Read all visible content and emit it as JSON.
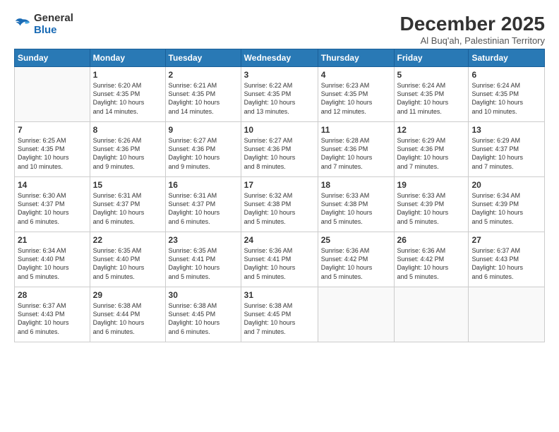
{
  "logo": {
    "line1": "General",
    "line2": "Blue"
  },
  "title": "December 2025",
  "subtitle": "Al Buq'ah, Palestinian Territory",
  "days_header": [
    "Sunday",
    "Monday",
    "Tuesday",
    "Wednesday",
    "Thursday",
    "Friday",
    "Saturday"
  ],
  "weeks": [
    [
      {
        "day": "",
        "info": ""
      },
      {
        "day": "1",
        "info": "Sunrise: 6:20 AM\nSunset: 4:35 PM\nDaylight: 10 hours\nand 14 minutes."
      },
      {
        "day": "2",
        "info": "Sunrise: 6:21 AM\nSunset: 4:35 PM\nDaylight: 10 hours\nand 14 minutes."
      },
      {
        "day": "3",
        "info": "Sunrise: 6:22 AM\nSunset: 4:35 PM\nDaylight: 10 hours\nand 13 minutes."
      },
      {
        "day": "4",
        "info": "Sunrise: 6:23 AM\nSunset: 4:35 PM\nDaylight: 10 hours\nand 12 minutes."
      },
      {
        "day": "5",
        "info": "Sunrise: 6:24 AM\nSunset: 4:35 PM\nDaylight: 10 hours\nand 11 minutes."
      },
      {
        "day": "6",
        "info": "Sunrise: 6:24 AM\nSunset: 4:35 PM\nDaylight: 10 hours\nand 10 minutes."
      }
    ],
    [
      {
        "day": "7",
        "info": "Sunrise: 6:25 AM\nSunset: 4:35 PM\nDaylight: 10 hours\nand 10 minutes."
      },
      {
        "day": "8",
        "info": "Sunrise: 6:26 AM\nSunset: 4:36 PM\nDaylight: 10 hours\nand 9 minutes."
      },
      {
        "day": "9",
        "info": "Sunrise: 6:27 AM\nSunset: 4:36 PM\nDaylight: 10 hours\nand 9 minutes."
      },
      {
        "day": "10",
        "info": "Sunrise: 6:27 AM\nSunset: 4:36 PM\nDaylight: 10 hours\nand 8 minutes."
      },
      {
        "day": "11",
        "info": "Sunrise: 6:28 AM\nSunset: 4:36 PM\nDaylight: 10 hours\nand 7 minutes."
      },
      {
        "day": "12",
        "info": "Sunrise: 6:29 AM\nSunset: 4:36 PM\nDaylight: 10 hours\nand 7 minutes."
      },
      {
        "day": "13",
        "info": "Sunrise: 6:29 AM\nSunset: 4:37 PM\nDaylight: 10 hours\nand 7 minutes."
      }
    ],
    [
      {
        "day": "14",
        "info": "Sunrise: 6:30 AM\nSunset: 4:37 PM\nDaylight: 10 hours\nand 6 minutes."
      },
      {
        "day": "15",
        "info": "Sunrise: 6:31 AM\nSunset: 4:37 PM\nDaylight: 10 hours\nand 6 minutes."
      },
      {
        "day": "16",
        "info": "Sunrise: 6:31 AM\nSunset: 4:37 PM\nDaylight: 10 hours\nand 6 minutes."
      },
      {
        "day": "17",
        "info": "Sunrise: 6:32 AM\nSunset: 4:38 PM\nDaylight: 10 hours\nand 5 minutes."
      },
      {
        "day": "18",
        "info": "Sunrise: 6:33 AM\nSunset: 4:38 PM\nDaylight: 10 hours\nand 5 minutes."
      },
      {
        "day": "19",
        "info": "Sunrise: 6:33 AM\nSunset: 4:39 PM\nDaylight: 10 hours\nand 5 minutes."
      },
      {
        "day": "20",
        "info": "Sunrise: 6:34 AM\nSunset: 4:39 PM\nDaylight: 10 hours\nand 5 minutes."
      }
    ],
    [
      {
        "day": "21",
        "info": "Sunrise: 6:34 AM\nSunset: 4:40 PM\nDaylight: 10 hours\nand 5 minutes."
      },
      {
        "day": "22",
        "info": "Sunrise: 6:35 AM\nSunset: 4:40 PM\nDaylight: 10 hours\nand 5 minutes."
      },
      {
        "day": "23",
        "info": "Sunrise: 6:35 AM\nSunset: 4:41 PM\nDaylight: 10 hours\nand 5 minutes."
      },
      {
        "day": "24",
        "info": "Sunrise: 6:36 AM\nSunset: 4:41 PM\nDaylight: 10 hours\nand 5 minutes."
      },
      {
        "day": "25",
        "info": "Sunrise: 6:36 AM\nSunset: 4:42 PM\nDaylight: 10 hours\nand 5 minutes."
      },
      {
        "day": "26",
        "info": "Sunrise: 6:36 AM\nSunset: 4:42 PM\nDaylight: 10 hours\nand 5 minutes."
      },
      {
        "day": "27",
        "info": "Sunrise: 6:37 AM\nSunset: 4:43 PM\nDaylight: 10 hours\nand 6 minutes."
      }
    ],
    [
      {
        "day": "28",
        "info": "Sunrise: 6:37 AM\nSunset: 4:43 PM\nDaylight: 10 hours\nand 6 minutes."
      },
      {
        "day": "29",
        "info": "Sunrise: 6:38 AM\nSunset: 4:44 PM\nDaylight: 10 hours\nand 6 minutes."
      },
      {
        "day": "30",
        "info": "Sunrise: 6:38 AM\nSunset: 4:45 PM\nDaylight: 10 hours\nand 6 minutes."
      },
      {
        "day": "31",
        "info": "Sunrise: 6:38 AM\nSunset: 4:45 PM\nDaylight: 10 hours\nand 7 minutes."
      },
      {
        "day": "",
        "info": ""
      },
      {
        "day": "",
        "info": ""
      },
      {
        "day": "",
        "info": ""
      }
    ]
  ]
}
